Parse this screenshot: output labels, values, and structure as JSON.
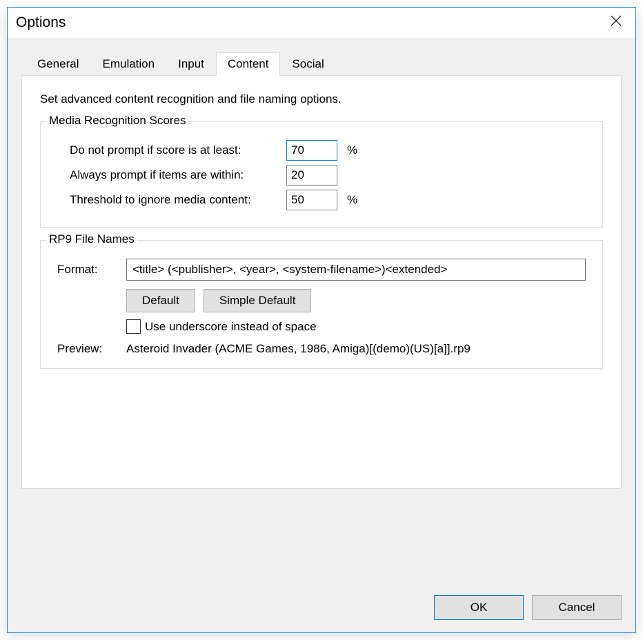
{
  "window": {
    "title": "Options"
  },
  "tabs": {
    "general": "General",
    "emulation": "Emulation",
    "input": "Input",
    "content": "Content",
    "social": "Social"
  },
  "content": {
    "description": "Set advanced content recognition and file naming options.",
    "media_group": {
      "legend": "Media Recognition Scores",
      "row1_label": "Do not prompt if score is at least:",
      "row1_value": "70",
      "row1_unit": "%",
      "row2_label": "Always prompt if items are within:",
      "row2_value": "20",
      "row3_label": "Threshold to ignore media content:",
      "row3_value": "50",
      "row3_unit": "%"
    },
    "rp9_group": {
      "legend": "RP9 File Names",
      "format_label": "Format:",
      "format_value": "<title> (<publisher>, <year>, <system-filename>)<extended>",
      "default_btn": "Default",
      "simple_default_btn": "Simple Default",
      "underscore_label": "Use underscore instead of space",
      "preview_label": "Preview:",
      "preview_value": "Asteroid Invader (ACME Games, 1986, Amiga)[(demo)(US)[a]].rp9"
    }
  },
  "buttons": {
    "ok": "OK",
    "cancel": "Cancel"
  }
}
